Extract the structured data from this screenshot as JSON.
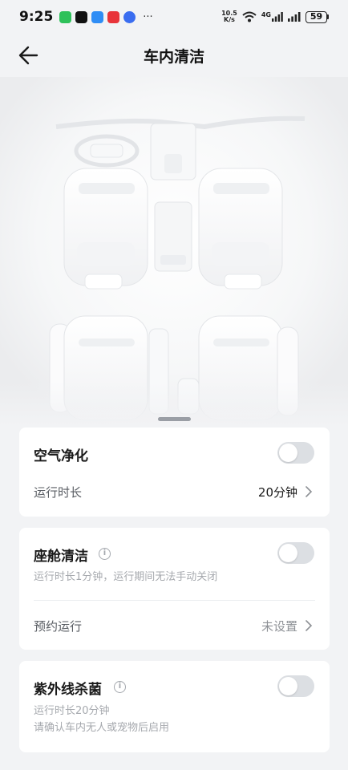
{
  "status_bar": {
    "time": "9:25",
    "more": "···",
    "net_speed_value": "10.5",
    "net_speed_unit": "K/s",
    "network": "4G",
    "battery": "59",
    "app_icons": [
      {
        "name": "wechat-icon",
        "color": "#2ec15a"
      },
      {
        "name": "tiktok-icon",
        "color": "#111111"
      },
      {
        "name": "cloud-app-icon",
        "color": "#2f8df5"
      },
      {
        "name": "red-app-icon",
        "color": "#e8343a"
      },
      {
        "name": "blue-app-icon",
        "color": "#3a6df0"
      }
    ]
  },
  "header": {
    "title": "车内清洁"
  },
  "air_purification": {
    "title": "空气净化",
    "enabled": false,
    "runtime_label": "运行时长",
    "runtime_value": "20分钟"
  },
  "cabin_cleaning": {
    "title": "座舱清洁",
    "enabled": false,
    "description": "运行时长1分钟，运行期间无法手动关闭",
    "schedule_label": "预约运行",
    "schedule_value": "未设置"
  },
  "uv_sterilization": {
    "title": "紫外线杀菌",
    "enabled": false,
    "description_line1": "运行时长20分钟",
    "description_line2": "请确认车内无人或宠物后启用"
  },
  "colors": {
    "background": "#f2f3f5",
    "card": "#ffffff",
    "toggle_off": "#dcdfe3",
    "secondary_text": "#595d63",
    "hint_text": "#a6a9ae",
    "value_text": "#1a1a1a",
    "unset_text": "#8e9196"
  }
}
